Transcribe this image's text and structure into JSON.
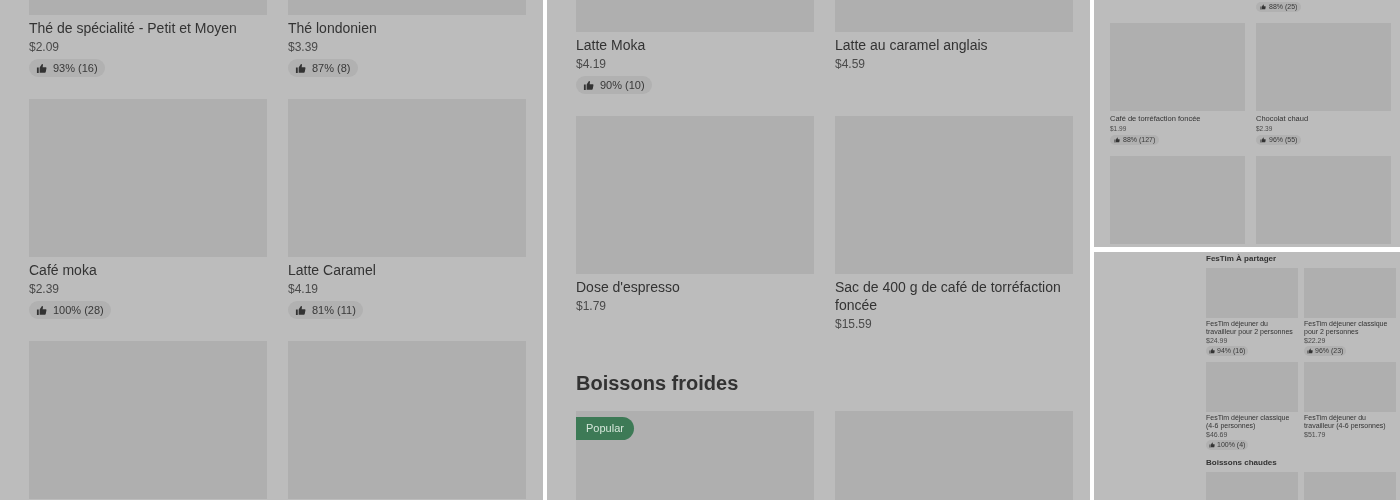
{
  "panels": [
    {
      "sections": [
        {
          "rows": [
            {
              "items": [
                {
                  "kind": "card",
                  "name": "Thé de spécialité - Petit et Moyen",
                  "price": "$2.09",
                  "rating": "93% (16)"
                },
                {
                  "kind": "card",
                  "name": "Thé londonien",
                  "price": "$3.39",
                  "rating": "87% (8)"
                }
              ]
            },
            {
              "items": [
                {
                  "kind": "card",
                  "name": "Café moka",
                  "price": "$2.39",
                  "rating": "100% (28)"
                },
                {
                  "kind": "card",
                  "name": "Latte Caramel",
                  "price": "$4.19",
                  "rating": "81% (11)"
                }
              ]
            },
            {
              "items": [
                {
                  "kind": "image_only"
                },
                {
                  "kind": "image_only"
                }
              ]
            }
          ]
        }
      ]
    },
    {
      "sections": [
        {
          "rows": [
            {
              "items": [
                {
                  "kind": "card",
                  "name": "Latte Moka",
                  "price": "$4.19",
                  "rating": "90% (10)"
                },
                {
                  "kind": "card",
                  "name": "Latte au caramel anglais",
                  "price": "$4.59"
                }
              ]
            },
            {
              "items": [
                {
                  "kind": "card",
                  "name": "Dose d'espresso",
                  "price": "$1.79"
                },
                {
                  "kind": "card",
                  "name": "Sac de 400 g de café de torréfaction foncée",
                  "price": "$15.59"
                }
              ]
            }
          ]
        },
        {
          "heading": "Boissons froides",
          "rows": [
            {
              "items": [
                {
                  "kind": "image_only",
                  "badge": "Popular"
                },
                {
                  "kind": "image_only"
                }
              ]
            }
          ]
        }
      ]
    },
    {
      "sections": [
        {
          "rows": [
            {
              "items": [
                {
                  "kind": "empty"
                },
                {
                  "kind": "rating_only",
                  "rating": "88% (25)"
                }
              ]
            },
            {
              "items": [
                {
                  "kind": "card",
                  "name": "Café de torréfaction foncée",
                  "price": "$1.99",
                  "rating": "88% (127)"
                },
                {
                  "kind": "card",
                  "name": "Chocolat chaud",
                  "price": "$2.39",
                  "rating": "96% (55)"
                }
              ]
            },
            {
              "items": [
                {
                  "kind": "image_only"
                },
                {
                  "kind": "image_only"
                }
              ]
            }
          ]
        }
      ]
    },
    {
      "sections": [
        {
          "heading": "FesTim À partager",
          "rows": [
            {
              "items": [
                {
                  "kind": "card",
                  "name": "FesTim déjeuner du travailleur pour 2 personnes",
                  "price": "$24.99",
                  "rating": "94% (16)"
                },
                {
                  "kind": "card",
                  "name": "FesTim déjeuner classique pour 2 personnes",
                  "price": "$22.29",
                  "rating": "96% (23)"
                }
              ]
            },
            {
              "items": [
                {
                  "kind": "card",
                  "name": "FesTim déjeuner classique (4-6 personnes)",
                  "price": "$46.69",
                  "rating": "100% (4)"
                },
                {
                  "kind": "card",
                  "name": "FesTim déjeuner du travailleur (4-6 personnes)",
                  "price": "$51.79"
                }
              ]
            }
          ]
        },
        {
          "heading": "Boissons chaudes",
          "rows": [
            {
              "items": [
                {
                  "kind": "image_only"
                },
                {
                  "kind": "image_only"
                }
              ]
            }
          ]
        }
      ]
    }
  ]
}
